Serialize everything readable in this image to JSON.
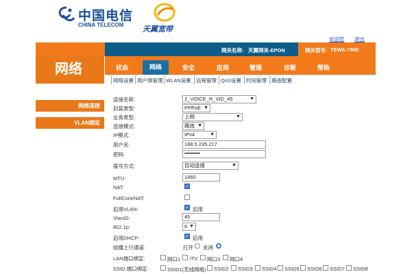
{
  "header": {
    "logo_cn": "中国电信",
    "logo_en": "CHINA TELECOM",
    "brand2": "天翼宽带",
    "link_welcome": "欢迎您",
    "link_logout": "退出",
    "gateway_name_label": "网关名称:",
    "gateway_name_value": "天翼网关-EPON",
    "gateway_model_label": "网关型号:",
    "gateway_model_value": "TEWA-750E"
  },
  "section_title": "网络",
  "tabs": [
    "状态",
    "网络",
    "安全",
    "应用",
    "管理",
    "诊断",
    "帮助"
  ],
  "active_tab": 1,
  "subnav": [
    "网络设置",
    "用户侧管理",
    "WLAN设置",
    "远程管理",
    "QoS设置",
    "时间管理",
    "路由配置"
  ],
  "sidebar": [
    "网络连接",
    "VLAN绑定"
  ],
  "form": {
    "conn_name_label": "连接名称:",
    "conn_name_value": "2_VOICE_R_VID_45",
    "encap_label": "封装类型:",
    "encap_value": "PPPoE",
    "service_label": "业务类型:",
    "service_value": "上网",
    "conn_mode_label": "连接模式:",
    "conn_mode_value": "路由",
    "ip_mode_label": "IP模式:",
    "ip_mode_value": "IPv4",
    "username_label": "用户名:",
    "username_value": "188.5.235.217",
    "password_label": "密码:",
    "password_value": "••••••••••••••",
    "dial_label": "拨号方式:",
    "dial_value": "自动连接",
    "mtu_label": "MTU:",
    "mtu_value": "1460",
    "nat_label": "NAT:",
    "fullcone_label": "FullConeNAT:",
    "vlan_enable_label": "启用VLAN:",
    "vlan_enable_text": "启用",
    "vlanid_label": "VlanID:",
    "vlanid_value": "45",
    "p8021_label": "802.1p:",
    "p8021_value": "6",
    "dhcp_label": "启用DHCP:",
    "dhcp_text": "启用",
    "multicast_label": "组播上行通道:",
    "multicast_on": "打开",
    "multicast_off": "关闭",
    "lan_bind_label": "LAN端口绑定:",
    "lan_ports": [
      "网口1",
      "iTV",
      "网口3",
      "网口4"
    ],
    "ssid_bind_label": "SSID 端口绑定:",
    "ssids": [
      "SSID1(无线网络)",
      "SSID2",
      "SSID3",
      "SSID4",
      "SSID5",
      "SSID6",
      "SSID7",
      "SSID8"
    ]
  },
  "colors": {
    "orange": "#f27a1b",
    "blue": "#0e5c88",
    "logo_blue": "#1a4f9c",
    "logo_red": "#d8262a"
  }
}
